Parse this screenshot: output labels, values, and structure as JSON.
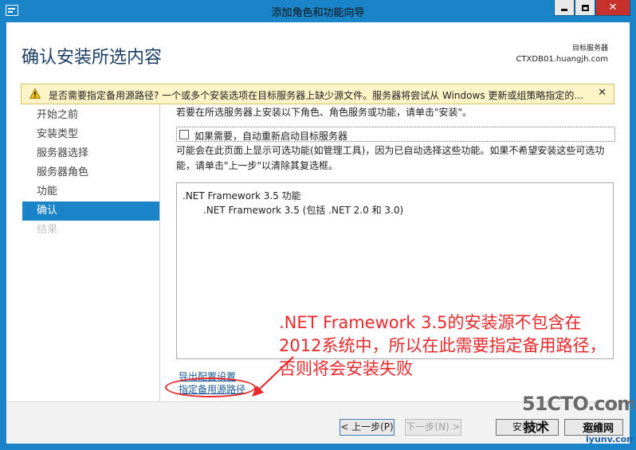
{
  "window": {
    "title": "添加角色和功能向导",
    "close_glyph": "✕"
  },
  "header": {
    "page_title": "确认安装所选内容",
    "target_label": "目标服务器",
    "target_name": "CTXDB01.huangjh.com"
  },
  "warning": {
    "text": "是否需要指定备用源路径? 一个或多个安装选项在目标服务器上缺少源文件。服务器将尝试从 Windows 更新或组策略指定的...",
    "close_glyph": "✕"
  },
  "nav": {
    "items": [
      {
        "label": "开始之前"
      },
      {
        "label": "安装类型"
      },
      {
        "label": "服务器选择"
      },
      {
        "label": "服务器角色"
      },
      {
        "label": "功能"
      },
      {
        "label": "确认"
      },
      {
        "label": "结果"
      }
    ]
  },
  "content": {
    "intro": "若要在所选服务器上安装以下角色、角色服务或功能，请单击\"安装\"。",
    "restart_label": "如果需要，自动重新启动目标服务器",
    "note": "可能会在此页面上显示可选功能(如管理工具)，因为已自动选择这些功能。如果不希望安装这些可选功能，请单击\"上一步\"以清除其复选框。",
    "features": {
      "head": ".NET Framework 3.5 功能",
      "sub": ".NET Framework 3.5 (包括 .NET 2.0 和 3.0)"
    },
    "export_link": "导出配置设置",
    "source_link": "指定备用源路径",
    "annotation": ".NET Framework 3.5的安装源不包含在2012系统中，所以在此需要指定备用路径，否则将会安装失败"
  },
  "footer": {
    "prev": "< 上一步(P)",
    "next": "下一步(N) >",
    "install": "安装(I)",
    "cancel": "取消"
  },
  "watermark": {
    "site": "51CTO.com",
    "sub": "技术",
    "brand": "运维网",
    "domain": "iyunv.com"
  }
}
